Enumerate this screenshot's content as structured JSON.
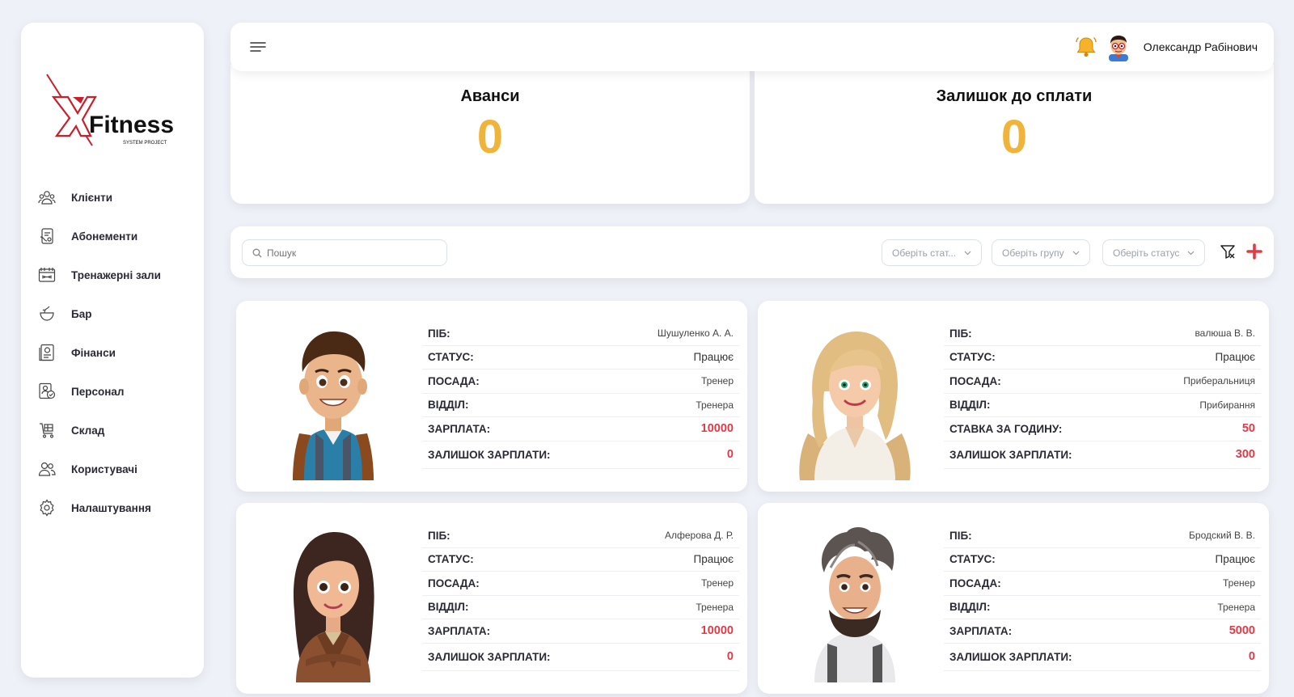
{
  "brand": {
    "name": "Fitness",
    "mark": "X",
    "tagline": "SYSTEM PROJECT"
  },
  "sidebar": {
    "items": [
      {
        "label": "Клієнти",
        "icon": "clients-icon"
      },
      {
        "label": "Абонементи",
        "icon": "subscriptions-icon"
      },
      {
        "label": "Тренажерні зали",
        "icon": "gym-icon"
      },
      {
        "label": "Бар",
        "icon": "bar-icon"
      },
      {
        "label": "Фінанси",
        "icon": "finance-icon"
      },
      {
        "label": "Персонал",
        "icon": "staff-icon"
      },
      {
        "label": "Склад",
        "icon": "warehouse-icon"
      },
      {
        "label": "Користувачі",
        "icon": "users-icon"
      },
      {
        "label": "Налаштування",
        "icon": "settings-icon"
      }
    ]
  },
  "header": {
    "username": "Олександр Рабінович"
  },
  "stats": [
    {
      "title": "Аванси",
      "value": "0"
    },
    {
      "title": "Залишок до сплати",
      "value": "0"
    }
  ],
  "filters": {
    "search_placeholder": "Пошук",
    "select_stat": "Оберіть стат...",
    "select_group": "Оберіть групу",
    "select_status": "Оберіть статус"
  },
  "labels": {
    "name": "ПІБ:",
    "status": "СТАТУС:",
    "position": "ПОСАДА:",
    "department": "ВІДДІЛ:",
    "salary": "ЗАРПЛАТА:",
    "hourly_rate": "СТАВКА ЗА ГОДИНУ:",
    "salary_balance": "ЗАЛИШОК ЗАРПЛАТИ:"
  },
  "employees": [
    {
      "name": "Шушуленко А. А.",
      "status": "Працює",
      "position": "Тренер",
      "department": "Тренера",
      "pay": "10000",
      "balance": "0"
    },
    {
      "name": "валюша В. В.",
      "status": "Працює",
      "position": "Приберальниця",
      "department": "Прибирання",
      "pay": "50",
      "balance": "300"
    },
    {
      "name": "Алферова Д. Р.",
      "status": "Працює",
      "position": "Тренер",
      "department": "Тренера",
      "pay": "10000",
      "balance": "0"
    },
    {
      "name": "Бродский В. В.",
      "status": "Працює",
      "position": "Тренер",
      "department": "Тренера",
      "pay": "5000",
      "balance": "0"
    }
  ],
  "colors": {
    "accent": "#f0b43a",
    "money": "#e53946",
    "brand_red": "#c8202b"
  }
}
